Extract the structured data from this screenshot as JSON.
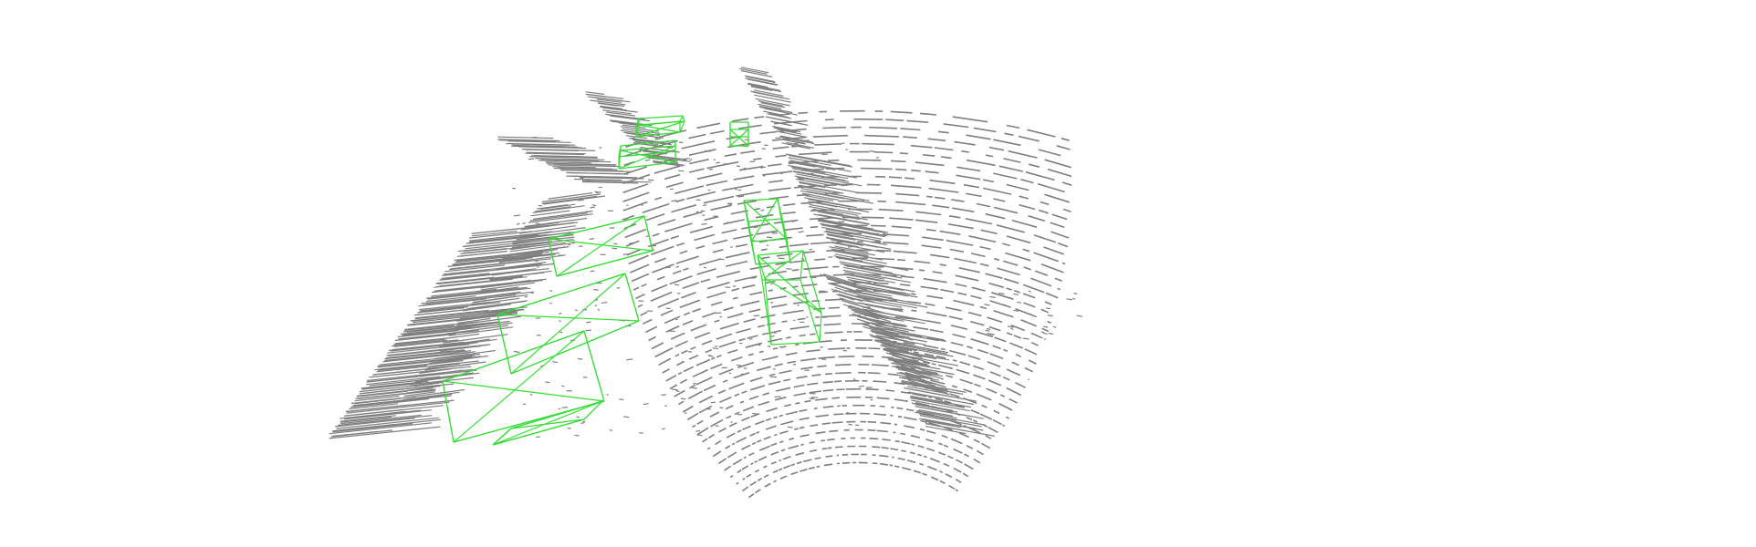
{
  "scene": {
    "kind": "lidar-point-cloud-3d-detections",
    "background_color": "#ffffff",
    "point_color": "#7f7f7f",
    "box_color": "#33dd33",
    "detected_object_count": 9
  }
}
